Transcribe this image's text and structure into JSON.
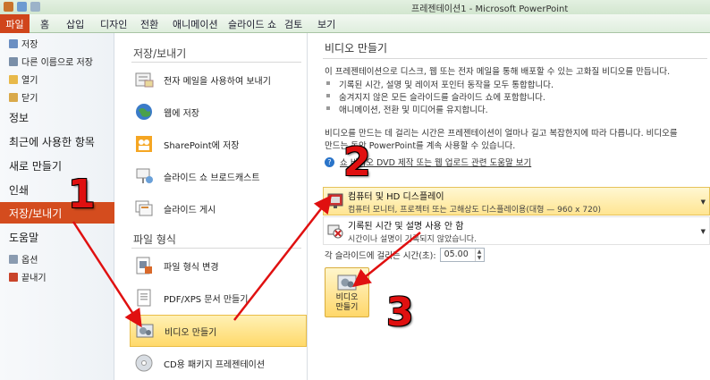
{
  "window": {
    "title": "프레젠테이션1 - Microsoft PowerPoint"
  },
  "ribbon": {
    "tabs": [
      "파일",
      "홈",
      "삽입",
      "디자인",
      "전환",
      "애니메이션",
      "슬라이드 쇼",
      "검토",
      "보기"
    ]
  },
  "left_menu": {
    "save": "저장",
    "save_as": "다른 이름으로 저장",
    "open": "열기",
    "close": "닫기",
    "info": "정보",
    "recent": "최근에 사용한 항목",
    "new": "새로 만들기",
    "print": "인쇄",
    "save_send": "저장/보내기",
    "help": "도움말",
    "options": "옵션",
    "exit": "끝내기"
  },
  "middle": {
    "save_send_header": "저장/보내기",
    "email": "전자 메일을 사용하여 보내기",
    "web": "웹에 저장",
    "sharepoint": "SharePoint에 저장",
    "broadcast": "슬라이드 쇼 브로드캐스트",
    "publish": "슬라이드 게시",
    "file_types_header": "파일 형식",
    "change_type": "파일 형식 변경",
    "pdf": "PDF/XPS 문서 만들기",
    "video": "비디오 만들기",
    "cd": "CD용 패키지 프레젠테이션"
  },
  "right": {
    "title": "비디오 만들기",
    "desc": "이 프레젠테이션으로 디스크, 웹 또는 전자 메일을 통해 배포할 수 있는 고화질 비디오를 만듭니다.",
    "bullets": [
      "기록된 시간, 설명 및 레이저 포인터 동작을 모두 통합합니다.",
      "숨겨지지 않은 모든 슬라이드를 슬라이드 쇼에 포함합니다.",
      "애니메이션, 전환 및 미디어를 유지합니다."
    ],
    "time_line1": "비디오를 만드는 데 걸리는 시간은 프레젠테이션이 얼마나 길고 복잡한지에 따라 다릅니다. 비디오를",
    "time_line2": "만드는 동안 PowerPoint를 계속 사용할 수 있습니다.",
    "help_link": "쇼 비디오 DVD 제작 또는 웹 업로드 관련 도움말 보기",
    "dropdown1_title": "컴퓨터 및 HD 디스플레이",
    "dropdown1_sub": "컴퓨터 모니터, 프로젝터 또는 고해상도 디스플레이용(대형 — 960 x 720)",
    "dropdown2_title": "기록된 시간 및 설명 사용 안 함",
    "dropdown2_sub": "시간이나 설명이 기록되지 않았습니다.",
    "seconds_label": "각 슬라이드에 걸리는 시간(초):",
    "seconds_value": "05.00",
    "make_button": "비디오\n만들기"
  },
  "annotations": {
    "n1": "1",
    "n2": "2",
    "n3": "3"
  },
  "colors": {
    "file_tab": "#d0451b",
    "selected_left": "#d44c1e",
    "highlight": "#ffd96a",
    "annotation": "#e01010"
  }
}
